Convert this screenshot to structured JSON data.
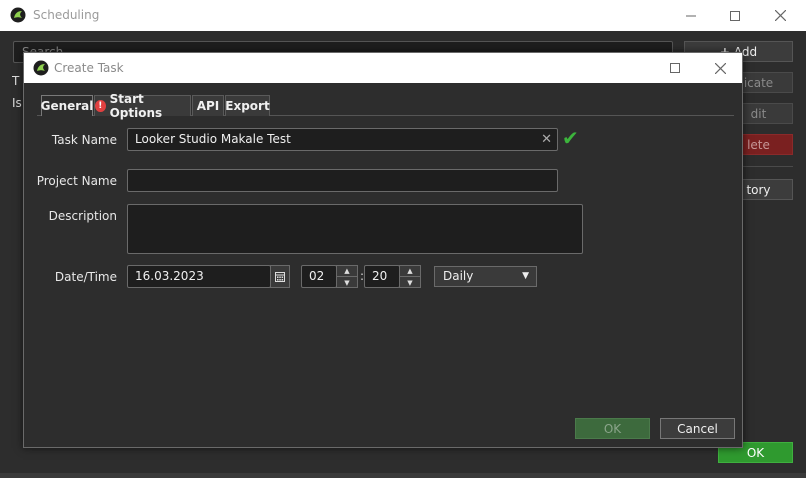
{
  "main_window": {
    "title": "Scheduling",
    "search_placeholder": "Search",
    "list_fragments": [
      "T",
      "Is"
    ],
    "buttons": {
      "add": "Add",
      "duplicate": "icate",
      "edit": "dit",
      "delete": "lete",
      "history": "tory",
      "ok": "OK"
    }
  },
  "dialog": {
    "title": "Create Task",
    "tabs": [
      {
        "label": "General",
        "active": true
      },
      {
        "label": "Start Options",
        "has_warning": true
      },
      {
        "label": "API"
      },
      {
        "label": "Export"
      }
    ],
    "fields": {
      "task_name_label": "Task Name",
      "task_name_value": "Looker Studio Makale Test",
      "project_name_label": "Project Name",
      "project_name_value": "",
      "description_label": "Description",
      "description_value": "",
      "datetime_label": "Date/Time",
      "date_value": "16.03.2023",
      "hour_value": "02",
      "minute_value": "20",
      "recurrence_value": "Daily"
    },
    "buttons": {
      "ok": "OK",
      "cancel": "Cancel"
    }
  },
  "icons": {
    "app_logo": "app-logo-icon",
    "minimize": "minimize-icon",
    "maximize": "maximize-icon",
    "close": "close-icon",
    "warning": "warning-icon",
    "check": "check-icon",
    "calendar": "calendar-icon",
    "clear": "clear-icon"
  },
  "colors": {
    "accent_green": "#2f9a2f",
    "delete_red": "#7a2020",
    "warning_red": "#e04040",
    "valid_check": "#3cb43c"
  }
}
